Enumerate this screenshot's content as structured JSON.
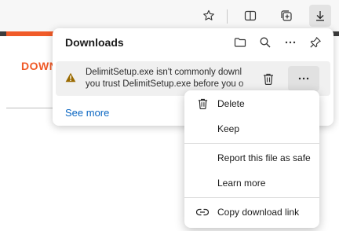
{
  "toolbar": {
    "icons": [
      "favorite-star-icon",
      "split-screen-icon",
      "collections-icon",
      "downloads-icon"
    ],
    "active": "downloads-icon"
  },
  "page": {
    "heading_fragment": "DOWN"
  },
  "downloads_panel": {
    "title": "Downloads",
    "header_icons": [
      "open-folder-icon",
      "search-icon",
      "more-options-icon",
      "pin-icon"
    ],
    "item": {
      "line1": "DelimitSetup.exe isn't commonly downl",
      "line2": "you trust DelimitSetup.exe before you o"
    },
    "see_more": "See more"
  },
  "context_menu": {
    "items": [
      {
        "label": "Delete",
        "icon": "trash-icon"
      },
      {
        "label": "Keep",
        "icon": ""
      },
      {
        "label": "Report this file as safe",
        "icon": ""
      },
      {
        "label": "Learn more",
        "icon": ""
      },
      {
        "label": "Copy download link",
        "icon": "link-icon"
      }
    ]
  },
  "colors": {
    "accent_link": "#0a66c2",
    "page_brand": "#f05a28",
    "warning": "#9a6a00"
  }
}
